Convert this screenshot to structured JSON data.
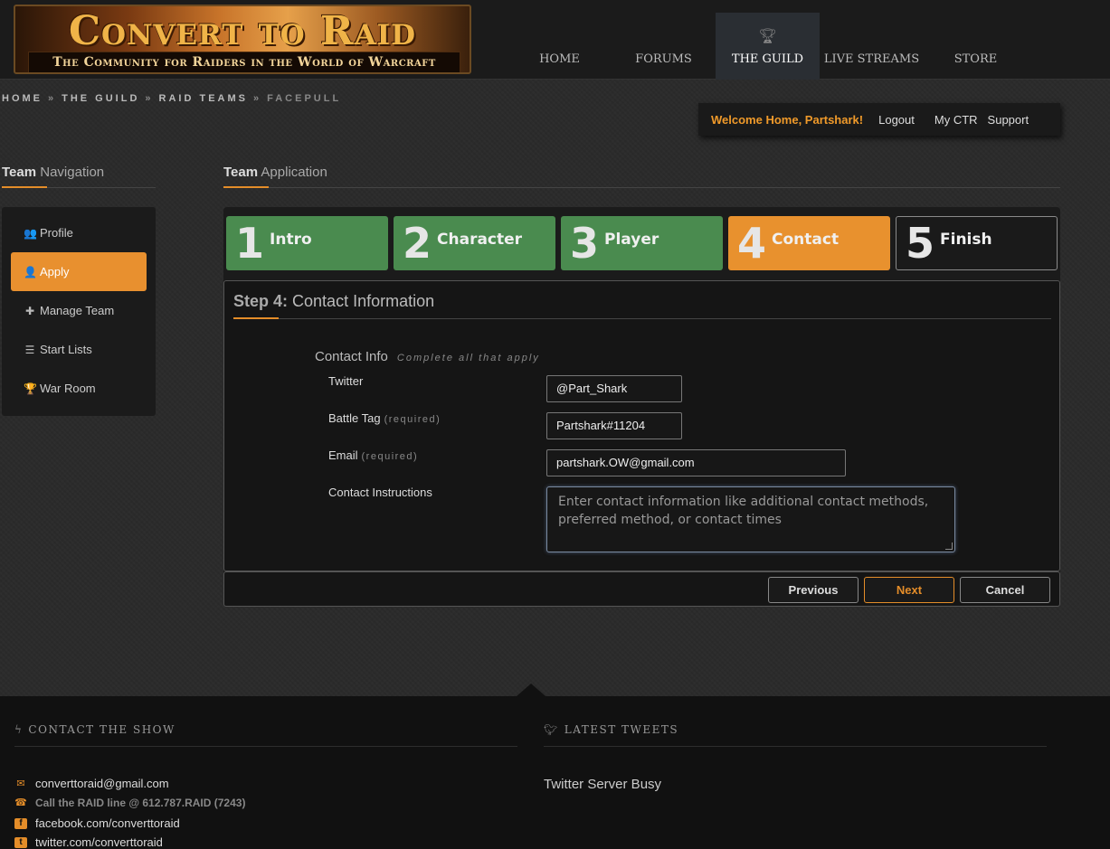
{
  "brand": {
    "title": "Convert to Raid",
    "subtitle": "The Community for Raiders in the World of Warcraft"
  },
  "nav": [
    {
      "label": "HOME",
      "active": false
    },
    {
      "label": "FORUMS",
      "active": false
    },
    {
      "label": "THE GUILD",
      "active": true,
      "icon": "trophy-icon"
    },
    {
      "label": "LIVE STREAMS",
      "active": false
    },
    {
      "label": "STORE",
      "active": false
    }
  ],
  "breadcrumb": [
    "HOME",
    "THE GUILD",
    "RAID TEAMS",
    "FACEPULL"
  ],
  "breadcrumb_sep": "»",
  "user": {
    "welcome": "Welcome Home, Partshark!",
    "logout": "Logout",
    "my_ctr": "My CTR",
    "support": "Support"
  },
  "team_nav": {
    "title_bold": "Team",
    "title_rest": "Navigation",
    "items": [
      {
        "label": "Profile",
        "icon": "users-icon",
        "glyph": "👥",
        "active": false
      },
      {
        "label": "Apply",
        "icon": "user-icon",
        "glyph": "👤",
        "active": true
      },
      {
        "label": "Manage Team",
        "icon": "puzzle-icon",
        "glyph": "✚",
        "active": false
      },
      {
        "label": "Start Lists",
        "icon": "list-icon",
        "glyph": "☰",
        "active": false
      },
      {
        "label": "War Room",
        "icon": "trophy-icon",
        "glyph": "🏆",
        "active": false
      }
    ]
  },
  "application": {
    "title_bold": "Team",
    "title_rest": "Application",
    "steps": [
      {
        "num": "1",
        "label": "Intro",
        "state": "done"
      },
      {
        "num": "2",
        "label": "Character",
        "state": "done"
      },
      {
        "num": "3",
        "label": "Player",
        "state": "done"
      },
      {
        "num": "4",
        "label": "Contact",
        "state": "current"
      },
      {
        "num": "5",
        "label": "Finish",
        "state": "todo"
      }
    ],
    "step_heading_bold": "Step 4:",
    "step_heading_rest": "Contact Information",
    "contact_info_title": "Contact Info",
    "contact_info_hint": "Complete all that apply",
    "fields": {
      "twitter": {
        "label": "Twitter",
        "value": "@Part_Shark"
      },
      "battletag": {
        "label": "Battle Tag",
        "req": "(required)",
        "value": "Partshark#11204"
      },
      "email": {
        "label": "Email",
        "req": "(required)",
        "value": "partshark.OW@gmail.com"
      },
      "instructions": {
        "label": "Contact Instructions",
        "placeholder": "Enter contact information like additional contact methods, preferred method, or contact times"
      }
    },
    "buttons": {
      "previous": "Previous",
      "next": "Next",
      "cancel": "Cancel"
    }
  },
  "footer": {
    "contact_title": "CONTACT THE SHOW",
    "tweets_title": "LATEST TWEETS",
    "email": "converttoraid@gmail.com",
    "phone": "Call the RAID line @ 612.787.RAID (7243)",
    "facebook": "facebook.com/converttoraid",
    "twitter": "twitter.com/converttoraid",
    "tweets_status": "Twitter Server Busy"
  },
  "colors": {
    "accent": "#e8902f",
    "step_done": "#4a8b4f",
    "bg": "#2a2a2a"
  }
}
